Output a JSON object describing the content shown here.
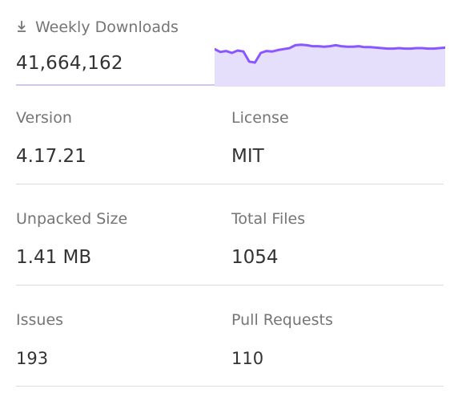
{
  "weekly_downloads": {
    "title": "Weekly Downloads",
    "icon": "download-icon",
    "count": "41,664,162",
    "sparkline_color": "#8956ff",
    "sparkline_fill": "#e5dffc",
    "sparkline_levels": [
      0.78,
      0.72,
      0.74,
      0.7,
      0.75,
      0.73,
      0.52,
      0.5,
      0.7,
      0.74,
      0.73,
      0.76,
      0.78,
      0.8,
      0.86,
      0.87,
      0.86,
      0.84,
      0.84,
      0.83,
      0.84,
      0.86,
      0.84,
      0.83,
      0.83,
      0.84,
      0.82,
      0.82,
      0.81,
      0.8,
      0.79,
      0.79,
      0.8,
      0.79,
      0.79,
      0.8,
      0.8,
      0.79,
      0.79,
      0.8,
      0.81
    ]
  },
  "stats": {
    "version": {
      "label": "Version",
      "value": "4.17.21"
    },
    "license": {
      "label": "License",
      "value": "MIT"
    },
    "unpacked_size": {
      "label": "Unpacked Size",
      "value": "1.41 MB"
    },
    "total_files": {
      "label": "Total Files",
      "value": "1054"
    },
    "issues": {
      "label": "Issues",
      "value": "193"
    },
    "pull_requests": {
      "label": "Pull Requests",
      "value": "110"
    }
  }
}
